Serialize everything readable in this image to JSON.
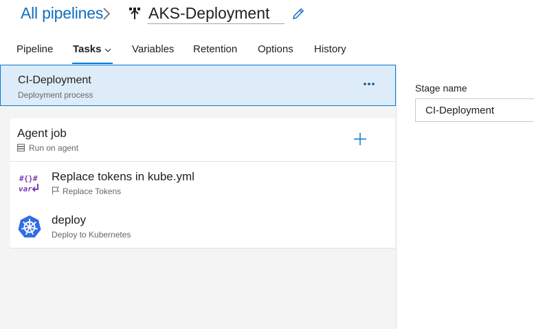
{
  "header": {
    "breadcrumb": "All pipelines",
    "pipeline_name": "AKS-Deployment"
  },
  "tabs": [
    {
      "label": "Pipeline",
      "active": false
    },
    {
      "label": "Tasks",
      "active": true
    },
    {
      "label": "Variables",
      "active": false
    },
    {
      "label": "Retention",
      "active": false
    },
    {
      "label": "Options",
      "active": false
    },
    {
      "label": "History",
      "active": false
    }
  ],
  "stage": {
    "title": "CI-Deployment",
    "subtitle": "Deployment process"
  },
  "job": {
    "title": "Agent job",
    "subtitle": "Run on agent"
  },
  "tasks": [
    {
      "title": "Replace tokens in kube.yml",
      "subtitle": "Replace Tokens",
      "icon": "replace-tokens-icon"
    },
    {
      "title": "deploy",
      "subtitle": "Deploy to Kubernetes",
      "icon": "kubernetes-icon"
    }
  ],
  "properties": {
    "stage_name_label": "Stage name",
    "stage_name_value": "CI-Deployment"
  },
  "colors": {
    "accent": "#0078d4",
    "link": "#106ebe",
    "selected_bg": "#deecf9",
    "panel_bg": "#f4f4f4",
    "token_purple": "#7b3fb6",
    "kubernetes_blue": "#326ce5"
  }
}
